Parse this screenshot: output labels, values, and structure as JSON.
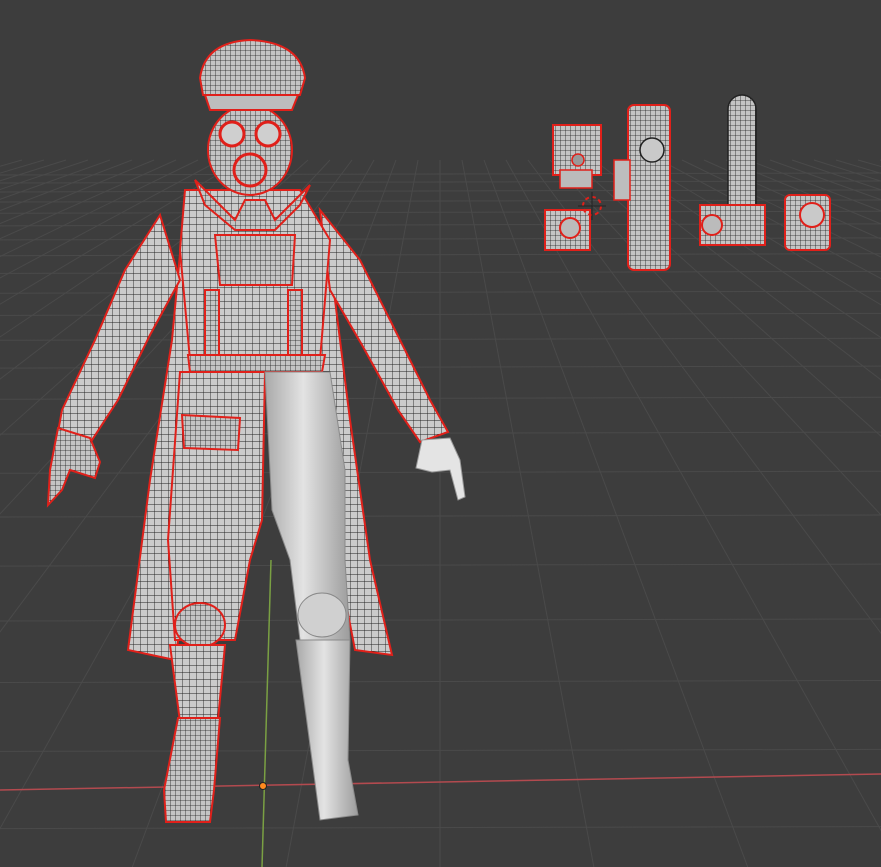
{
  "viewport": {
    "background_color": "#3d3d3d",
    "grid_color": "#4a4a4a",
    "x_axis_color": "#b34a4f",
    "y_axis_color": "#7aa043",
    "wire_color": "#1c1c1c",
    "seam_color": "#e0201a",
    "mesh_color": "#c9c9c9",
    "solid_color": "#d6d6d6"
  },
  "scene": {
    "main_model": "character-gasmask-officer",
    "props": [
      "lantern-prop",
      "flashlight-prop",
      "camera-prop",
      "canister-prop",
      "radio-prop"
    ],
    "cursor_icon": "3d-cursor-icon",
    "origin_icon": "origin-dot-icon"
  }
}
